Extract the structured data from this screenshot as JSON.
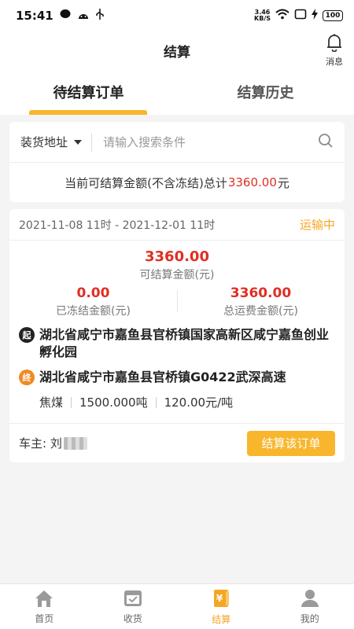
{
  "status_bar": {
    "time": "15:41",
    "net_speed": "3.46",
    "net_unit": "KB/S",
    "battery": "100"
  },
  "header": {
    "title": "结算",
    "message_label": "消息"
  },
  "tabs": [
    {
      "label": "待结算订单",
      "active": true
    },
    {
      "label": "结算历史",
      "active": false
    }
  ],
  "search": {
    "filter_label": "装货地址",
    "placeholder": "请输入搜索条件"
  },
  "summary": {
    "prefix": "当前可结算金额(不含冻结)总计",
    "amount": "3360.00",
    "suffix": "元"
  },
  "order": {
    "date_range": "2021-11-08 11时 - 2021-12-01 11时",
    "status": "运输中",
    "settleable_amount": "3360.00",
    "settleable_label": "可结算金额(元)",
    "frozen_amount": "0.00",
    "frozen_label": "已冻结金额(元)",
    "total_freight": "3360.00",
    "total_freight_label": "总运费金额(元)",
    "start_badge": "起",
    "start_address": "湖北省咸宁市嘉鱼县官桥镇国家高新区咸宁嘉鱼创业孵化园",
    "end_badge": "终",
    "end_address": "湖北省咸宁市嘉鱼县官桥镇G0422武深高速",
    "cargo": "焦煤",
    "weight": "1500.000吨",
    "unit_price": "120.00元/吨",
    "owner_label": "车主: 刘",
    "settle_button": "结算该订单"
  },
  "nav": [
    {
      "label": "首页",
      "icon": "home-icon",
      "active": false
    },
    {
      "label": "收货",
      "icon": "receive-icon",
      "active": false
    },
    {
      "label": "结算",
      "icon": "settle-icon",
      "active": true
    },
    {
      "label": "我的",
      "icon": "profile-icon",
      "active": false
    }
  ],
  "colors": {
    "accent": "#f8b62d",
    "amount": "#e02e24",
    "status": "#f5a623"
  }
}
